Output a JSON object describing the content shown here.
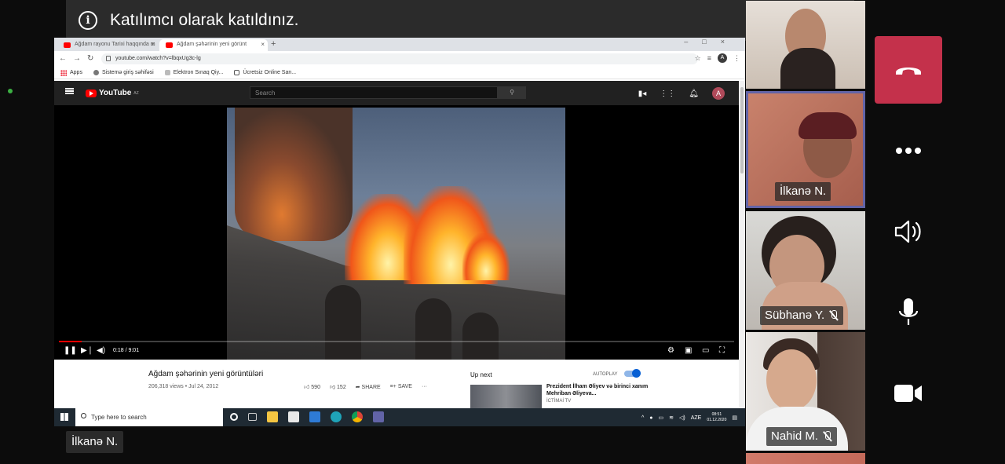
{
  "meeting": {
    "notification_text": "Katılımcı olarak katıldınız.",
    "presenter_name": "İlkanə N."
  },
  "participants": [
    {
      "name": ""
    },
    {
      "name": "İlkanə N.",
      "active_speaker": true
    },
    {
      "name": "Sübhanə Y.",
      "muted": true
    },
    {
      "name": "Nahid M.",
      "muted": true
    }
  ],
  "controls": {
    "hangup_icon": "phone-hangup-icon",
    "more_icon": "more-icon",
    "speaker_icon": "speaker-icon",
    "mic_icon": "microphone-icon",
    "camera_icon": "camera-icon"
  },
  "shared_screen": {
    "browser": {
      "tabs": [
        {
          "title": "Ağdam rayonu Tarixi haqqında m"
        },
        {
          "title": "Ağdam şəhərinin yeni görünt",
          "active": true
        }
      ],
      "url": "youtube.com/watch?v=lbqxUg3c-lg",
      "bookmarks": [
        "Apps",
        "Sistemə giriş səhifəsi",
        "Elektron Sınaq Qiy...",
        "Ücretsiz Online San..."
      ],
      "profile_initial": "A"
    },
    "youtube": {
      "logo_text": "YouTube",
      "logo_region": "AZ",
      "search_placeholder": "Search",
      "avatar_initial": "A",
      "time": "0:18 / 9:01",
      "video_title": "Ağdam şəhərinin yeni görüntüləri",
      "meta": "206,318 views • Jul 24, 2012",
      "likes": "590",
      "dislikes": "152",
      "share": "SHARE",
      "save": "SAVE",
      "up_next": "Up next",
      "autoplay": "AUTOPLAY",
      "rec_title": "Prezident İlham Əliyev və birinci xanım Mehriban Əliyeva...",
      "rec_channel": "İCTİMAİ TV"
    },
    "taskbar": {
      "search_placeholder": "Type here to search",
      "language": "AZE",
      "time": "08:51",
      "date": "01.12.2020"
    }
  },
  "colors": {
    "hangup": "#c4314b",
    "active_speaker_border": "#6264a7",
    "youtube_red": "#ff0000"
  }
}
